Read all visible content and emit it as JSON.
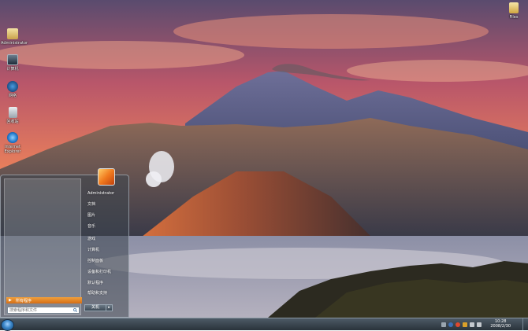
{
  "desktop": {
    "icons": [
      {
        "label": "Administrator",
        "icon": "folder-user-icon"
      },
      {
        "label": "计算机",
        "icon": "computer-icon"
      },
      {
        "label": "网络",
        "icon": "network-icon"
      },
      {
        "label": "回收站",
        "icon": "recycle-bin-icon"
      },
      {
        "label": "Internet Explorer",
        "icon": "ie-icon"
      },
      {
        "label": "Files",
        "icon": "folder-icon"
      }
    ]
  },
  "start_menu": {
    "all_programs": "所有程序",
    "search_placeholder": "搜索程序和文件",
    "right_items": [
      "Administrator",
      "文档",
      "图片",
      "音乐",
      "游戏",
      "计算机",
      "控制面板",
      "设备和打印机",
      "默认程序",
      "帮助和支持"
    ],
    "shutdown_label": "关机",
    "shutdown_arrow": "▸"
  },
  "taskbar": {
    "tray": {
      "time": "10:28",
      "date": "2008/2/30"
    }
  },
  "colors": {
    "start_orb": "#3b86c8",
    "all_programs_bar": "#e3862a",
    "taskbar": "#2a333b"
  }
}
